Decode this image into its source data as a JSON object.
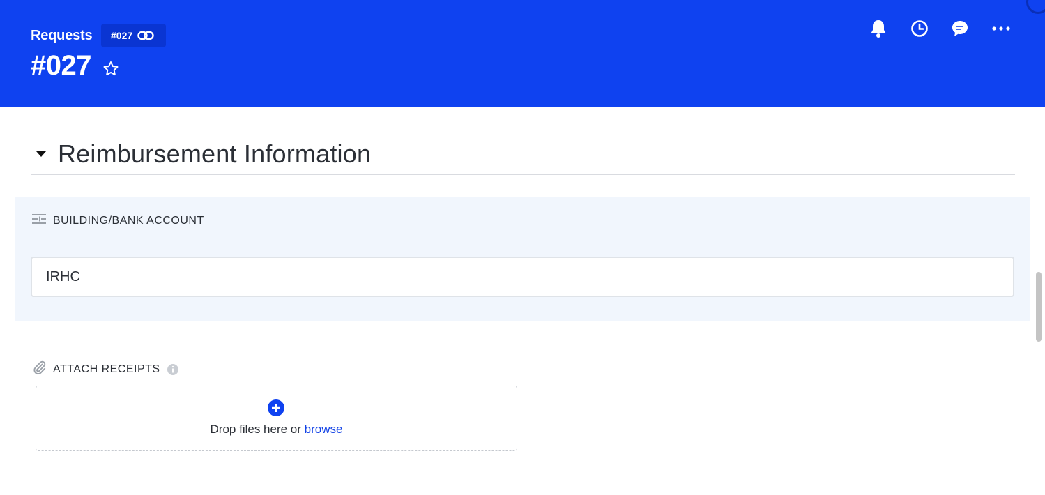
{
  "header": {
    "breadcrumb": "Requests",
    "id_chip": "#027",
    "title": "#027",
    "background_color": "#0f42f0",
    "icons": [
      "star-icon",
      "link-icon",
      "bell-icon",
      "clock-icon",
      "chat-icon",
      "more-icon"
    ]
  },
  "section": {
    "title": "Reimbursement Information"
  },
  "building_field": {
    "label": "BUILDING/BANK ACCOUNT",
    "value": "IRHC",
    "icon": "sliders-icon"
  },
  "attach": {
    "label": "ATTACH RECEIPTS",
    "icon": "paperclip-icon",
    "info_icon": "info-icon",
    "drop_text": "Drop files here or ",
    "browse_text": "browse",
    "accent_color": "#1444e6"
  }
}
